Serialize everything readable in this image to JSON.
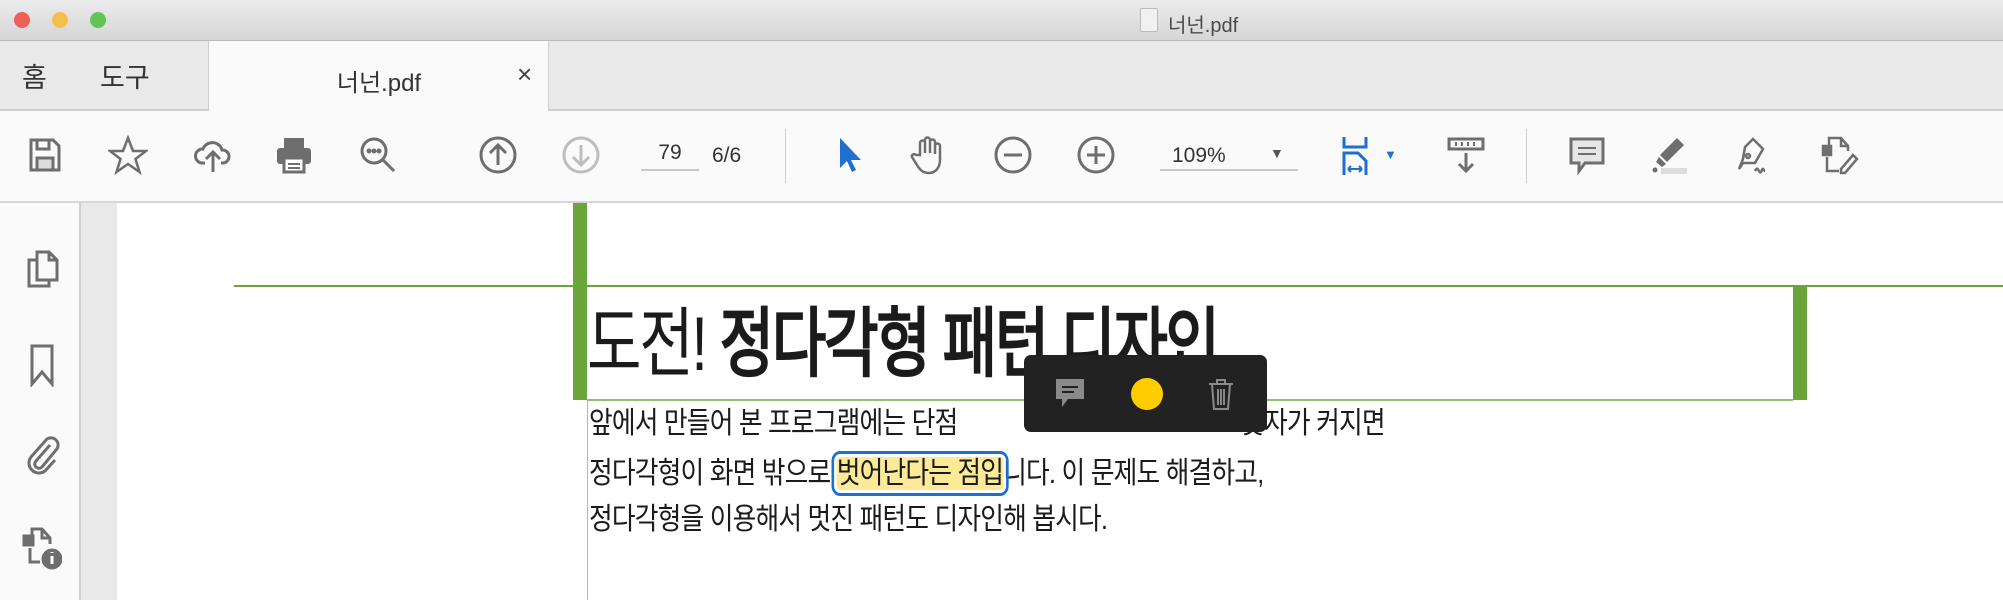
{
  "window": {
    "title": "너넌.pdf",
    "controls": [
      "close",
      "minimize",
      "zoom"
    ]
  },
  "tabs": {
    "home": "홈",
    "tools": "도구",
    "document": "너넌.pdf",
    "close": "×"
  },
  "toolbar": {
    "page_current": "79",
    "page_count": "6/6",
    "zoom": "109%",
    "icons": [
      "save-icon",
      "star-icon",
      "cloud-upload-icon",
      "print-icon",
      "search-icon",
      "page-up-icon",
      "page-down-icon",
      "select-pointer-icon",
      "hand-icon",
      "zoom-out-icon",
      "zoom-in-icon",
      "fit-page-icon",
      "scroll-mode-icon",
      "comment-icon",
      "highlight-icon",
      "sign-icon",
      "edit-pdf-icon"
    ]
  },
  "sidebar": {
    "icons": [
      "page-thumbnails-icon",
      "bookmark-icon",
      "attachment-icon",
      "document-properties-icon"
    ]
  },
  "document": {
    "title_light": "도전!",
    "title_bold": "정다각형 패턴 디자인",
    "line1_a": "앞에서 만들어 본 프로그램에는 단점",
    "line1_b": "숫자가 커지면",
    "line2_a": "정다각형이 화면 밖으로 ",
    "line2_highlight": "벗어난다는 점입",
    "line2_b": "니다. 이 문제도 해결하고,",
    "line3": "정다각형을 이용해서 멋진 패턴도 디자인해 봅시다."
  },
  "annotation_popup": {
    "icons": [
      "comment-icon",
      "color-icon",
      "delete-icon"
    ],
    "color": "#ffcc00"
  },
  "colors": {
    "accent": "#1f6fd0",
    "guide": "#6aa53a",
    "highlight": "#fdea98"
  }
}
